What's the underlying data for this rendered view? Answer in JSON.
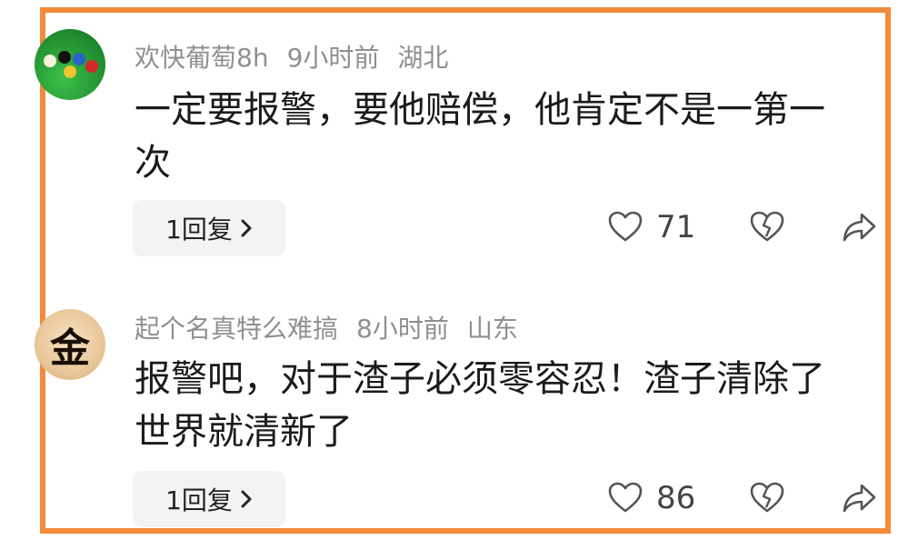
{
  "comments": [
    {
      "username": "欢快葡萄8h",
      "time": "9小时前",
      "location": "湖北",
      "text_line1": "一定要报警，要他赔偿，他肯定不是一第一",
      "text_line2": "次",
      "reply_label": "1回复",
      "likes": "71",
      "avatar_icon": "billiard-balls-avatar"
    },
    {
      "username": "起个名真特么难搞",
      "time": "8小时前",
      "location": "山东",
      "text_line1": "报警吧，对于渣子必须零容忍！渣子清除了",
      "text_line2": "世界就清新了",
      "reply_label": "1回复",
      "likes": "86",
      "avatar_char": "金",
      "avatar_icon": "gold-character-avatar"
    }
  ],
  "colors": {
    "frame": "#f28c3a",
    "meta_text": "#8f8f8f",
    "body_text": "#1b1b1b",
    "reply_bg": "#f3f3f3"
  },
  "icons": [
    "heart-icon",
    "dislike-heart-icon",
    "share-icon",
    "chevron-right-icon"
  ]
}
